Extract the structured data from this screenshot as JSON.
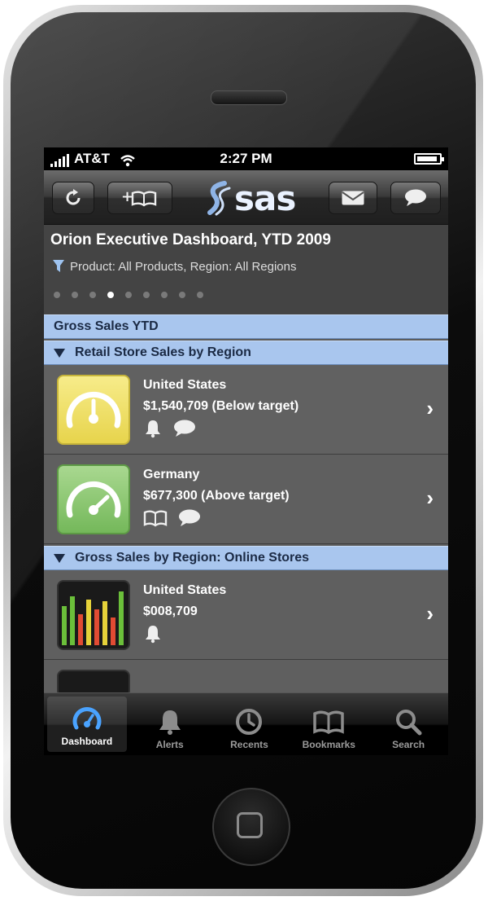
{
  "status": {
    "carrier": "AT&T",
    "time": "2:27 PM"
  },
  "toolbar": {
    "brand": "sas",
    "buttons": [
      "refresh-icon",
      "bookmark-add-icon",
      "mail-icon",
      "comment-icon"
    ]
  },
  "header": {
    "title": "Orion Executive Dashboard, YTD 2009",
    "filter": "Product: All Products, Region: All Regions",
    "page_count": 9,
    "active_page": 4
  },
  "sections": {
    "gross_sales": "Gross Sales YTD",
    "retail": "Retail Store Sales by Region",
    "online": "Gross Sales by Region: Online Stores"
  },
  "rows": [
    {
      "name": "United States",
      "value": "$1,540,709 (Below target)",
      "status_color": "#e8d54a",
      "icons": [
        "alert-icon",
        "comment-icon"
      ]
    },
    {
      "name": "Germany",
      "value": "$677,300 (Above target)",
      "status_color": "#7dbb5f",
      "icons": [
        "bookmark-icon",
        "comment-icon"
      ]
    },
    {
      "name": "United States",
      "value": "$008,709",
      "icons": [
        "alert-icon"
      ]
    }
  ],
  "tabs": [
    {
      "label": "Dashboard",
      "icon": "dashboard-icon",
      "active": true
    },
    {
      "label": "Alerts",
      "icon": "bell-icon",
      "active": false
    },
    {
      "label": "Recents",
      "icon": "clock-icon",
      "active": false
    },
    {
      "label": "Bookmarks",
      "icon": "book-icon",
      "active": false
    },
    {
      "label": "Search",
      "icon": "search-icon",
      "active": false
    }
  ]
}
